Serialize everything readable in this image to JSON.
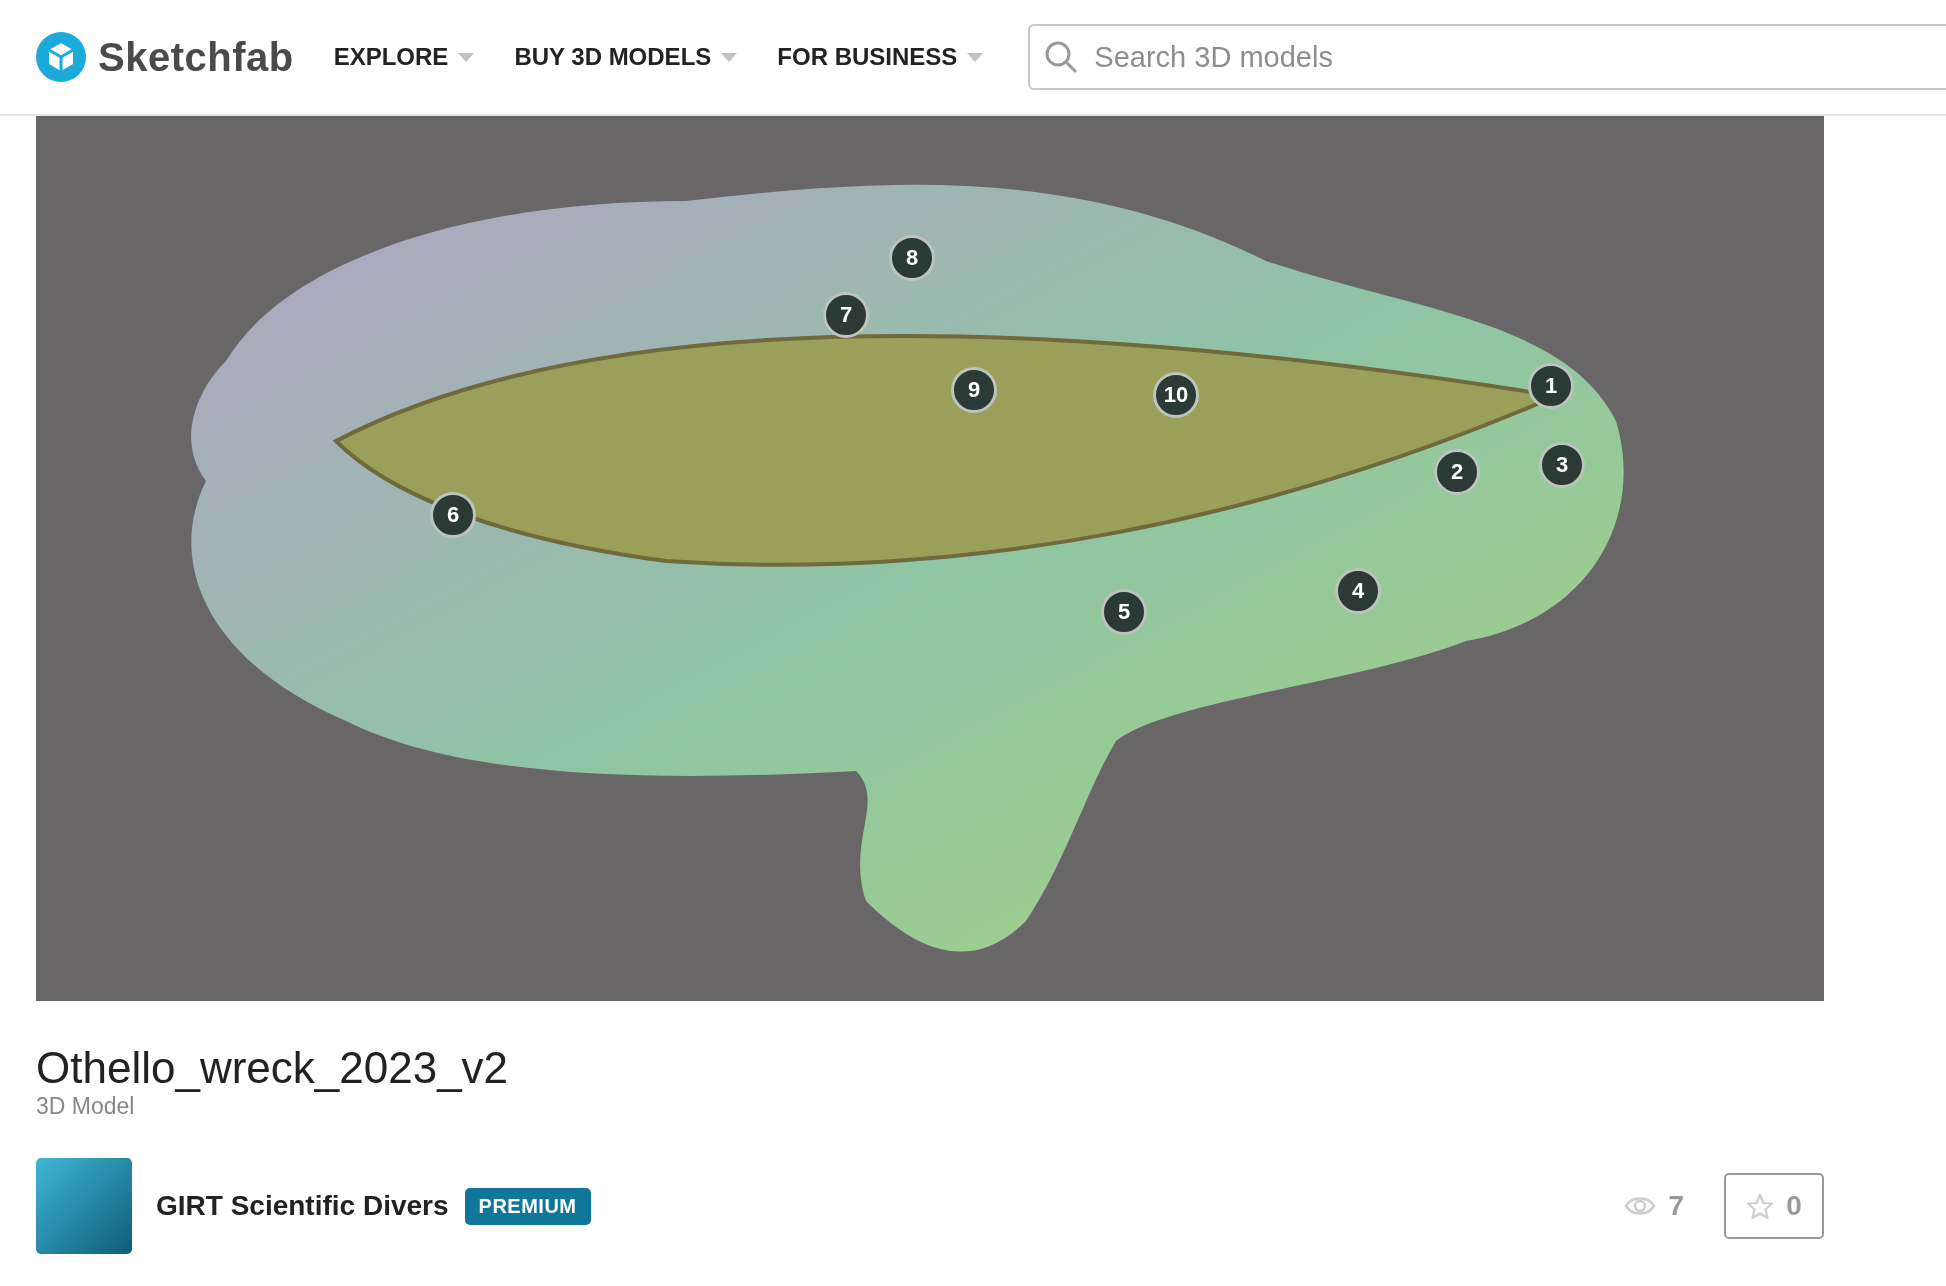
{
  "header": {
    "logo": "Sketchfab",
    "nav": [
      {
        "label": "EXPLORE"
      },
      {
        "label": "BUY 3D MODELS"
      },
      {
        "label": "FOR BUSINESS"
      }
    ],
    "search": {
      "placeholder": "Search 3D models"
    }
  },
  "viewer": {
    "hotspots": [
      "1",
      "2",
      "3",
      "4",
      "5",
      "6",
      "7",
      "8",
      "9",
      "10"
    ]
  },
  "model": {
    "title": "Othello_wreck_2023_v2",
    "subtitle": "3D Model"
  },
  "author": {
    "name": "GIRT Scientific Divers",
    "badge": "PREMIUM"
  },
  "stats": {
    "views": "7",
    "likes": "0"
  }
}
